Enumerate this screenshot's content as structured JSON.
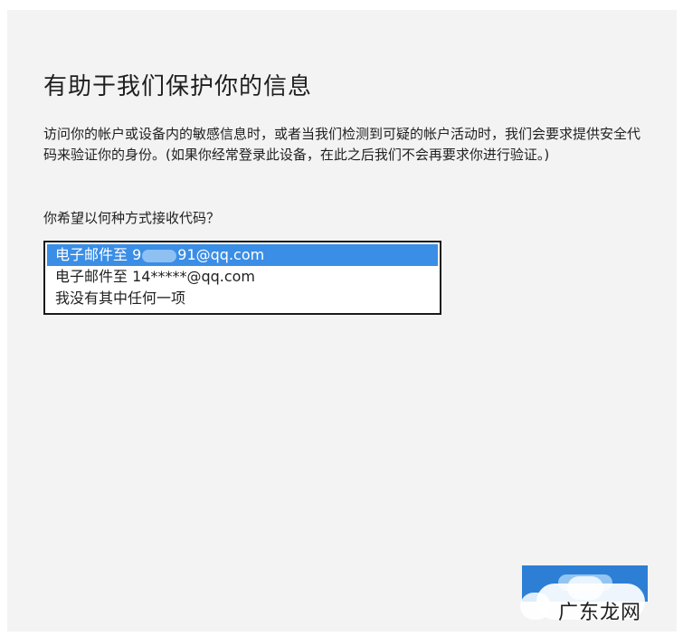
{
  "page": {
    "title": "有助于我们保护你的信息",
    "description": "访问你的帐户或设备内的敏感信息时，或者当我们检测到可疑的帐户活动时，我们会要求提供安全代码来验证你的身份。(如果你经常登录此设备，在此之后我们不会再要求你进行验证。)",
    "question": "你希望以何种方式接收代码？"
  },
  "options": [
    {
      "prefix": "电子邮件至 9",
      "suffix": "91@qq.com",
      "selected": true
    },
    {
      "label": "电子邮件至 14*****@qq.com",
      "selected": false
    },
    {
      "label": "我没有其中任何一项",
      "selected": false
    }
  ],
  "watermark": {
    "text": "广东龙网"
  },
  "colors": {
    "panel_bg": "#f3f3f3",
    "selection": "#3a8ee6",
    "button": "#2d7fd6"
  }
}
